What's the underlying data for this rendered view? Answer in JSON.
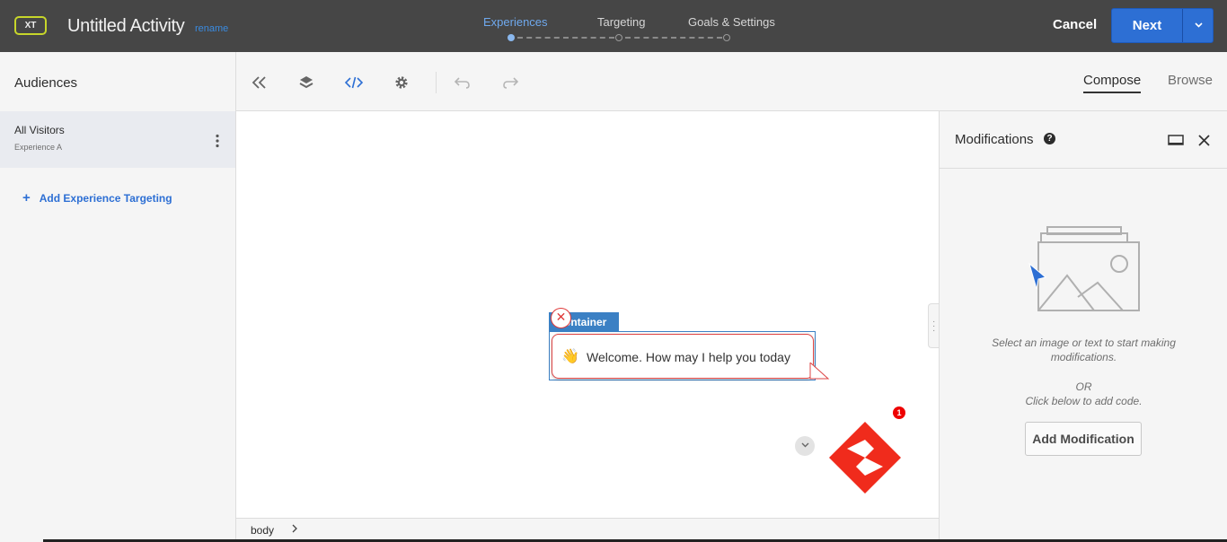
{
  "header": {
    "badge": "XT",
    "title": "Untitled Activity",
    "rename": "rename",
    "steps": [
      {
        "label": "Experiences",
        "active": true
      },
      {
        "label": "Targeting",
        "active": false
      },
      {
        "label": "Goals & Settings",
        "active": false
      }
    ],
    "cancel": "Cancel",
    "next": "Next"
  },
  "sidebar": {
    "title": "Audiences",
    "audience": {
      "name": "All Visitors",
      "experience": "Experience A"
    },
    "add_targeting": "Add Experience Targeting"
  },
  "toolbar": {
    "compose": "Compose",
    "browse": "Browse"
  },
  "canvas": {
    "container_label": "ontainer",
    "welcome_text": "Welcome. How may I help you today",
    "notification_count": "1"
  },
  "breadcrumb": {
    "item": "body"
  },
  "modifications": {
    "title": "Modifications",
    "empty_line1": "Select an image or text to start making",
    "empty_line2": "modifications.",
    "or": "OR",
    "click_below": "Click below to add code.",
    "add_button": "Add Modification"
  },
  "colors": {
    "accent": "#2d6fd4",
    "header_bg": "#464646",
    "badge_border": "#c7d62a",
    "brand_red": "#f02b1c"
  }
}
